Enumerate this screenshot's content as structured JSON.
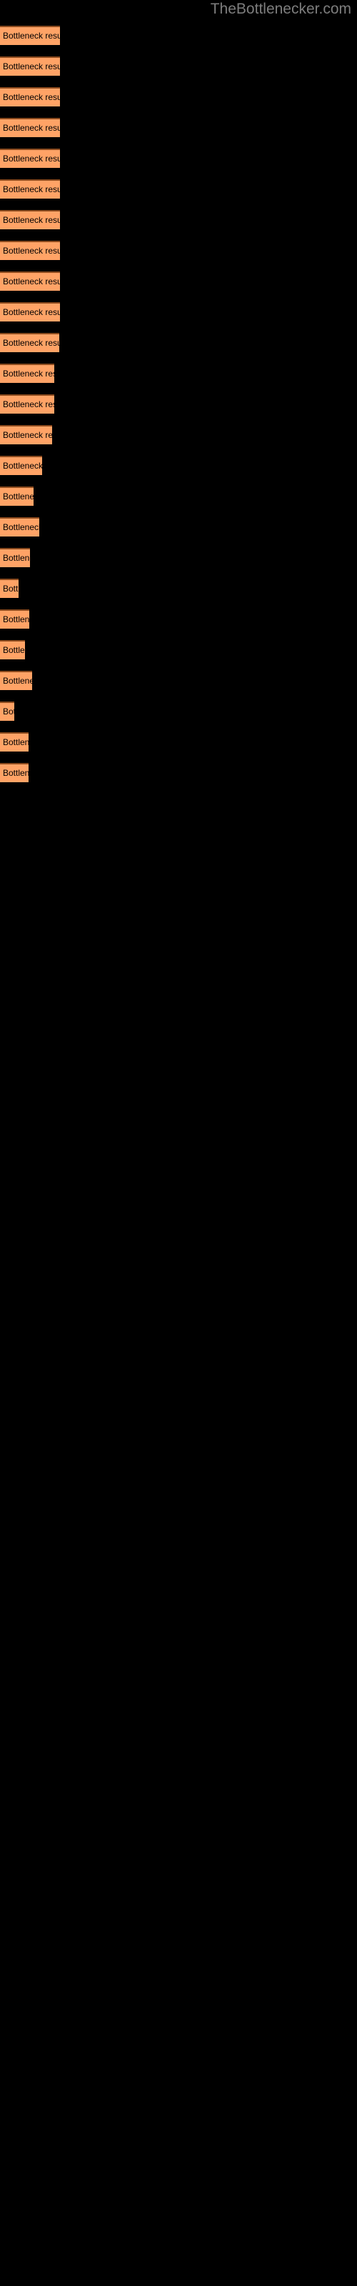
{
  "site": {
    "title": "TheBottlenecker.com",
    "title_color": "#7d7d7d",
    "background_color": "#000000"
  },
  "chart_data": {
    "type": "bar",
    "orientation": "horizontal",
    "title": "TheBottlenecker.com",
    "xlabel": "",
    "ylabel": "",
    "bar_color": "#ffa366",
    "bar_border_color": "#8a4a1e",
    "label_color": "#000000",
    "grid": false,
    "legend": false,
    "xlim": [
      0,
      100
    ],
    "categories": [
      "Bottleneck result",
      "Bottleneck result",
      "Bottleneck result",
      "Bottleneck result",
      "Bottleneck result",
      "Bottleneck result",
      "Bottleneck result",
      "Bottleneck result",
      "Bottleneck result",
      "Bottleneck result",
      "Bottleneck result",
      "Bottleneck result",
      "Bottleneck result",
      "Bottleneck result",
      "Bottleneck result",
      "Bottleneck result",
      "Bottleneck result",
      "Bottleneck result",
      "Bottleneck result",
      "Bottleneck result",
      "Bottleneck result",
      "Bottleneck result",
      "Bottleneck result",
      "Bottleneck result",
      "Bottleneck result"
    ],
    "values": [
      84,
      84,
      84,
      84,
      84,
      84,
      84,
      84,
      84,
      84,
      83,
      76,
      76,
      73,
      59,
      47,
      55,
      42,
      26,
      41,
      35,
      45,
      20,
      40,
      40
    ],
    "bars": [
      {
        "label": "Bottleneck result",
        "width": 84
      },
      {
        "label": "Bottleneck result",
        "width": 84
      },
      {
        "label": "Bottleneck result",
        "width": 84
      },
      {
        "label": "Bottleneck result",
        "width": 84
      },
      {
        "label": "Bottleneck result",
        "width": 84
      },
      {
        "label": "Bottleneck result",
        "width": 84
      },
      {
        "label": "Bottleneck result",
        "width": 84
      },
      {
        "label": "Bottleneck result",
        "width": 84
      },
      {
        "label": "Bottleneck result",
        "width": 84
      },
      {
        "label": "Bottleneck result",
        "width": 84
      },
      {
        "label": "Bottleneck result",
        "width": 83
      },
      {
        "label": "Bottleneck result",
        "width": 76
      },
      {
        "label": "Bottleneck result",
        "width": 76
      },
      {
        "label": "Bottleneck result",
        "width": 73
      },
      {
        "label": "Bottleneck result",
        "width": 59
      },
      {
        "label": "Bottleneck result",
        "width": 47
      },
      {
        "label": "Bottleneck result",
        "width": 55
      },
      {
        "label": "Bottleneck result",
        "width": 42
      },
      {
        "label": "Bottleneck result",
        "width": 26
      },
      {
        "label": "Bottleneck result",
        "width": 41
      },
      {
        "label": "Bottleneck result",
        "width": 35
      },
      {
        "label": "Bottleneck result",
        "width": 45
      },
      {
        "label": "Bottleneck result",
        "width": 20
      },
      {
        "label": "Bottleneck result",
        "width": 40
      },
      {
        "label": "Bottleneck result",
        "width": 40
      }
    ]
  }
}
